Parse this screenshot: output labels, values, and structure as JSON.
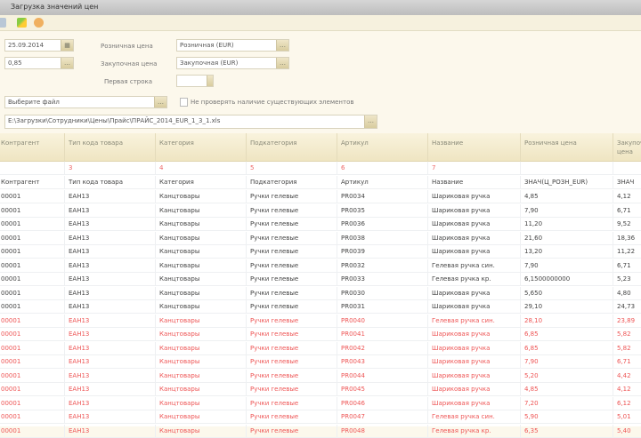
{
  "window": {
    "title": "Загрузка значений цен"
  },
  "toolbar": {
    "icons": [
      "save-icon",
      "refresh-icon",
      "settings-icon"
    ]
  },
  "form": {
    "date": "25.09.2014",
    "coef": "0,85",
    "retail_price_label": "Розничная цена",
    "retail_price_value": "Розничная (EUR)",
    "purchase_price_label": "Закупочная цена",
    "purchase_price_value": "Закупочная (EUR)",
    "first_row_label": "Первая строка",
    "first_row_value": "",
    "file_type": "Выберите файл",
    "checkbox_label": "Не проверять наличие существующих элементов",
    "file_path": "E:\\Загрузки\\Сотрудники\\Цены\\Прайс\\ПРАЙС_2014_EUR_1_3_1.xls"
  },
  "table": {
    "columns": [
      "Контрагент",
      "Тип кода товара",
      "Категория",
      "Подкатегория",
      "Артикул",
      "Название",
      "Розничная цена",
      "Закупочная цена"
    ],
    "column_numbers": [
      "",
      "3",
      "4",
      "5",
      "6",
      "7",
      "",
      ""
    ],
    "template_row": [
      "Контрагент",
      "Тип кода товара",
      "Категория",
      "Подкатегория",
      "Артикул",
      "Название",
      "ЗНАЧ(Ц_РОЗН_EUR)",
      "ЗНАЧ"
    ],
    "rows": [
      {
        "cells": [
          "00001",
          "ЕАН13",
          "Канцтовары",
          "Ручки гелевые",
          "PR0034",
          "Шариковая ручка",
          "4,85",
          "4,12"
        ],
        "error": false
      },
      {
        "cells": [
          "00001",
          "ЕАН13",
          "Канцтовары",
          "Ручки гелевые",
          "PR0035",
          "Шариковая ручка",
          "7,90",
          "6,71"
        ],
        "error": false
      },
      {
        "cells": [
          "00001",
          "ЕАН13",
          "Канцтовары",
          "Ручки гелевые",
          "PR0036",
          "Шариковая ручка",
          "11,20",
          "9,52"
        ],
        "error": false
      },
      {
        "cells": [
          "00001",
          "ЕАН13",
          "Канцтовары",
          "Ручки гелевые",
          "PR0038",
          "Шариковая ручка",
          "21,60",
          "18,36"
        ],
        "error": false
      },
      {
        "cells": [
          "00001",
          "ЕАН13",
          "Канцтовары",
          "Ручки гелевые",
          "PR0039",
          "Шариковая ручка",
          "13,20",
          "11,22"
        ],
        "error": false
      },
      {
        "cells": [
          "00001",
          "ЕАН13",
          "Канцтовары",
          "Ручки гелевые",
          "PR0032",
          "Гелевая ручка син.",
          "7,90",
          "6,71"
        ],
        "error": false
      },
      {
        "cells": [
          "00001",
          "ЕАН13",
          "Канцтовары",
          "Ручки гелевые",
          "PR0033",
          "Гелевая ручка кр.",
          "6,1500000000",
          "5,23"
        ],
        "error": false
      },
      {
        "cells": [
          "00001",
          "ЕАН13",
          "Канцтовары",
          "Ручки гелевые",
          "PR0030",
          "Шариковая ручка",
          "5,650",
          "4,80"
        ],
        "error": false
      },
      {
        "cells": [
          "00001",
          "ЕАН13",
          "Канцтовары",
          "Ручки гелевые",
          "PR0031",
          "Шариковая ручка",
          "29,10",
          "24,73"
        ],
        "error": false
      },
      {
        "cells": [
          "00001",
          "ЕАН13",
          "Канцтовары",
          "Ручки гелевые",
          "PR0040",
          "Гелевая ручка син.",
          "28,10",
          "23,89"
        ],
        "error": true
      },
      {
        "cells": [
          "00001",
          "ЕАН13",
          "Канцтовары",
          "Ручки гелевые",
          "PR0041",
          "Шариковая ручка",
          "6,85",
          "5,82"
        ],
        "error": true
      },
      {
        "cells": [
          "00001",
          "ЕАН13",
          "Канцтовары",
          "Ручки гелевые",
          "PR0042",
          "Шариковая ручка",
          "6,85",
          "5,82"
        ],
        "error": true
      },
      {
        "cells": [
          "00001",
          "ЕАН13",
          "Канцтовары",
          "Ручки гелевые",
          "PR0043",
          "Шариковая ручка",
          "7,90",
          "6,71"
        ],
        "error": true
      },
      {
        "cells": [
          "00001",
          "ЕАН13",
          "Канцтовары",
          "Ручки гелевые",
          "PR0044",
          "Шариковая ручка",
          "5,20",
          "4,42"
        ],
        "error": true
      },
      {
        "cells": [
          "00001",
          "ЕАН13",
          "Канцтовары",
          "Ручки гелевые",
          "PR0045",
          "Шариковая ручка",
          "4,85",
          "4,12"
        ],
        "error": true
      },
      {
        "cells": [
          "00001",
          "ЕАН13",
          "Канцтовары",
          "Ручки гелевые",
          "PR0046",
          "Шариковая ручка",
          "7,20",
          "6,12"
        ],
        "error": true
      },
      {
        "cells": [
          "00001",
          "ЕАН13",
          "Канцтовары",
          "Ручки гелевые",
          "PR0047",
          "Гелевая ручка син.",
          "5,90",
          "5,01"
        ],
        "error": true
      },
      {
        "cells": [
          "00001",
          "ЕАН13",
          "Канцтовары",
          "Ручки гелевые",
          "PR0048",
          "Гелевая ручка кр.",
          "6,35",
          "5,40"
        ],
        "error": true
      }
    ]
  }
}
